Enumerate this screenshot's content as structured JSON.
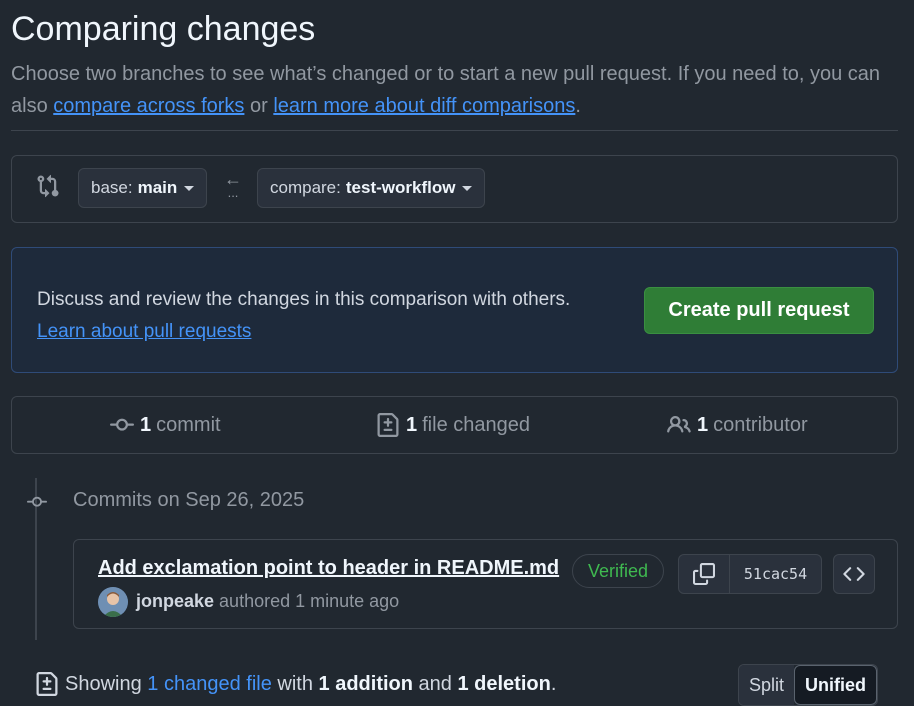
{
  "header": {
    "title": "Comparing changes",
    "subtitle_prefix": "Choose two branches to see what’s changed or to start a new pull request. If you need to, you can also ",
    "link_forks": "compare across forks",
    "subtitle_mid": " or ",
    "link_learn_diff": "learn more about diff comparisons",
    "subtitle_suffix": "."
  },
  "range": {
    "base_prefix": "base:",
    "base_branch": "main",
    "compare_prefix": "compare:",
    "compare_branch": "test-workflow",
    "arrow": "←",
    "dots": "..."
  },
  "flash": {
    "message": "Discuss and review the changes in this comparison with others.",
    "link": "Learn about pull requests",
    "button": "Create pull request"
  },
  "stats": {
    "commits_count": "1",
    "commits_label": "commit",
    "files_count": "1",
    "files_label": "file changed",
    "contributors_count": "1",
    "contributors_label": "contributor"
  },
  "commits": {
    "date_heading": "Commits on Sep 26, 2025",
    "items": [
      {
        "title": "Add exclamation point to header in README.md",
        "badge": "Verified",
        "sha": "51cac54",
        "author": "jonpeake",
        "action": "authored",
        "time": "1 minute ago"
      }
    ]
  },
  "summary": {
    "prefix": "Showing",
    "changed_link": "1 changed file",
    "with": "with",
    "additions": "1 addition",
    "and": "and",
    "deletions": "1 deletion",
    "period": "."
  },
  "view_toggle": {
    "split": "Split",
    "unified": "Unified",
    "selected": "Unified"
  },
  "colors": {
    "bg": "#212830",
    "accent_link": "#4493f8",
    "primary_button": "#2f7d36",
    "verified": "#3fb950"
  }
}
